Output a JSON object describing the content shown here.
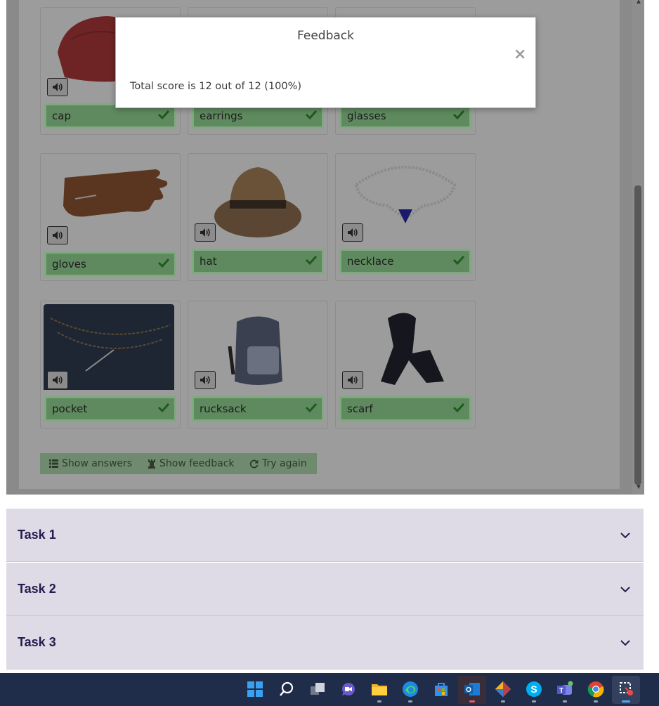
{
  "modal": {
    "title": "Feedback",
    "close": "×",
    "message": "Total score is 12 out of 12 (100%)"
  },
  "cards": [
    {
      "label": "cap",
      "icon": "cap-image"
    },
    {
      "label": "earrings",
      "icon": "earrings-image"
    },
    {
      "label": "glasses",
      "icon": "glasses-image"
    },
    {
      "label": "gloves",
      "icon": "gloves-image"
    },
    {
      "label": "hat",
      "icon": "hat-image"
    },
    {
      "label": "necklace",
      "icon": "necklace-image"
    },
    {
      "label": "pocket",
      "icon": "pocket-image"
    },
    {
      "label": "rucksack",
      "icon": "rucksack-image"
    },
    {
      "label": "scarf",
      "icon": "scarf-image"
    }
  ],
  "buttons": {
    "show_answers": "Show answers",
    "show_feedback": "Show feedback",
    "try_again": "Try again"
  },
  "tasks": [
    "Task 1",
    "Task 2",
    "Task 3"
  ],
  "colors": {
    "correct_bg": "#9ad39a",
    "accordion_bg": "#dedbe6",
    "accordion_text": "#241c4e",
    "taskbar_bg": "#1f2d4a"
  },
  "taskbar": [
    "start-icon",
    "search-icon",
    "task-view-icon",
    "chat-icon",
    "file-explorer-icon",
    "edge-icon",
    "store-icon",
    "outlook-icon",
    "git-icon",
    "skype-icon",
    "teams-icon",
    "chrome-icon",
    "snipping-tool-icon"
  ]
}
